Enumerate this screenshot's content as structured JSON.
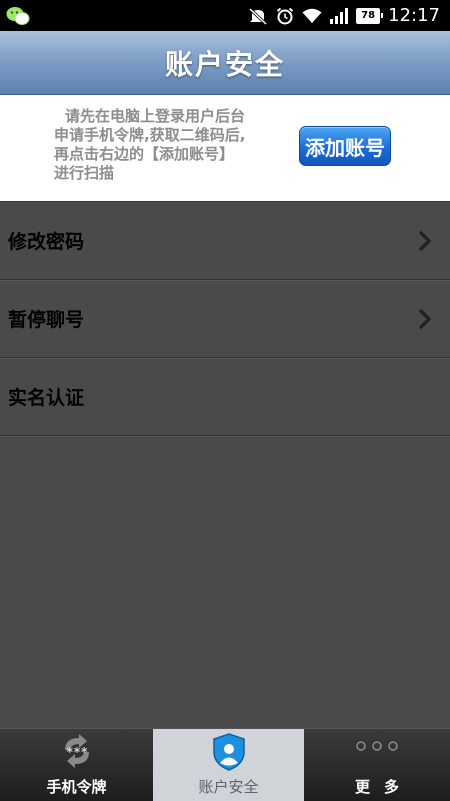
{
  "status_bar": {
    "time": "12:17",
    "battery": "78",
    "icons": [
      "wechat-icon",
      "mute-icon",
      "alarm-icon",
      "wifi-icon",
      "signal-icon",
      "battery-icon"
    ]
  },
  "header": {
    "title": "账户安全"
  },
  "hint": {
    "line1": "请先在电脑上登录用户后台",
    "line2": "申请手机令牌,获取二维码后,",
    "line3": "再点击右边的【添加账号】",
    "line4": "进行扫描"
  },
  "add_account_button": "添加账号",
  "menu": {
    "items": [
      {
        "label": "修改密码",
        "has_arrow": true
      },
      {
        "label": "暂停聊号",
        "has_arrow": true
      },
      {
        "label": "实名认证",
        "has_arrow": false
      }
    ]
  },
  "tabs": [
    {
      "label": "手机令牌",
      "icon": "token-refresh-icon",
      "selected": false
    },
    {
      "label": "账户安全",
      "icon": "shield-user-icon",
      "selected": true
    },
    {
      "label": "更多",
      "icon": "more-dots-icon",
      "selected": false
    }
  ],
  "colors": {
    "title_gradient_top": "#a9c0dc",
    "title_gradient_bottom": "#5d81b0",
    "button_blue": "#1b6ed9",
    "list_background": "#4a4a4a",
    "selected_tab": "#d0d3d8"
  }
}
